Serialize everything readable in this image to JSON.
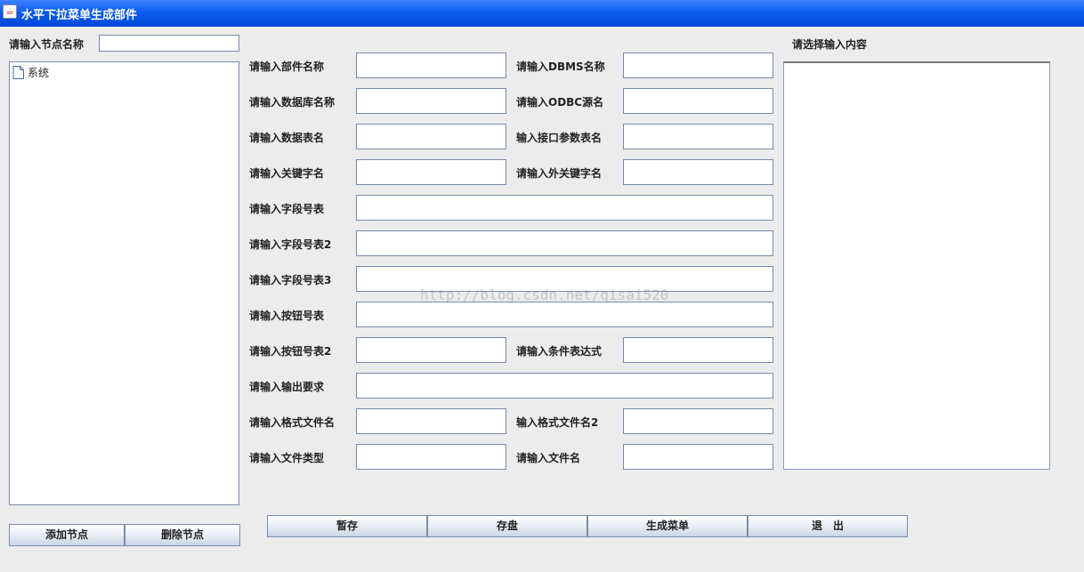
{
  "window": {
    "title": "水平下拉菜单生成部件"
  },
  "left": {
    "node_label": "请输入节点名称",
    "node_value": "",
    "tree": [
      {
        "label": "系统"
      }
    ],
    "add_button": "添加节点",
    "delete_button": "删除节点"
  },
  "form": {
    "component_name": {
      "label": "请输入部件名称",
      "value": ""
    },
    "dbms_name": {
      "label": "请输入DBMS名称",
      "value": ""
    },
    "database_name": {
      "label": "请输入数据库名称",
      "value": ""
    },
    "odbc_source": {
      "label": "请输入ODBC源名",
      "value": ""
    },
    "table_name": {
      "label": "请输入数据表名",
      "value": ""
    },
    "interface_param_table": {
      "label": "输入接口参数表名",
      "value": ""
    },
    "key_field": {
      "label": "请输入关键字名",
      "value": ""
    },
    "foreign_key_field": {
      "label": "请输入外关键字名",
      "value": ""
    },
    "field_list": {
      "label": "请输入字段号表",
      "value": ""
    },
    "field_list2": {
      "label": "请输入字段号表2",
      "value": ""
    },
    "field_list3": {
      "label": "请输入字段号表3",
      "value": ""
    },
    "button_list": {
      "label": "请输入按钮号表",
      "value": ""
    },
    "button_list2": {
      "label": "请输入按钮号表2",
      "value": ""
    },
    "condition_expr": {
      "label": "请输入条件表达式",
      "value": ""
    },
    "output_requirement": {
      "label": "请输入输出要求",
      "value": ""
    },
    "format_file_name": {
      "label": "请输入格式文件名",
      "value": ""
    },
    "format_file_name2": {
      "label": "输入格式文件名2",
      "value": ""
    },
    "file_type": {
      "label": "请输入文件类型",
      "value": ""
    },
    "file_name": {
      "label": "请输入文件名",
      "value": ""
    }
  },
  "right": {
    "label": "请选择输入内容",
    "content": ""
  },
  "buttons": {
    "save_temp": "暂存",
    "save_disk": "存盘",
    "generate_menu": "生成菜单",
    "exit": "退　出"
  },
  "watermark": "http://blog.csdn.net/qisai520"
}
